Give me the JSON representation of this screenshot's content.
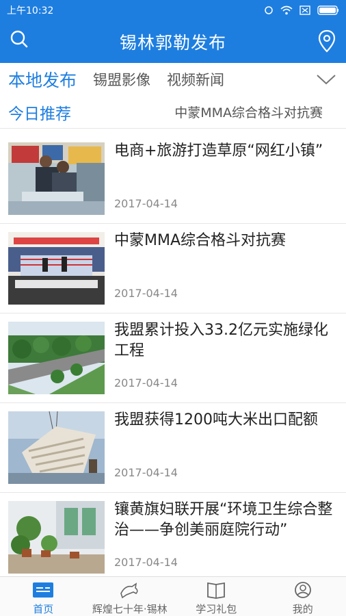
{
  "status": {
    "time": "上午10:32"
  },
  "appbar": {
    "title": "锡林郭勒发布"
  },
  "tabs": [
    {
      "label": "本地发布"
    },
    {
      "label": "锡盟影像"
    },
    {
      "label": "视频新闻"
    }
  ],
  "subtabs": {
    "active": "今日推荐",
    "other": "中蒙MMA综合格斗对抗赛"
  },
  "feed": [
    {
      "title": "电商+旅游打造草原“网红小镇”",
      "date": "2017-04-14"
    },
    {
      "title": "中蒙MMA综合格斗对抗赛",
      "date": "2017-04-14"
    },
    {
      "title": "我盟累计投入33.2亿元实施绿化工程",
      "date": "2017-04-14"
    },
    {
      "title": "我盟获得1200吨大米出口配额",
      "date": "2017-04-14"
    },
    {
      "title": "镶黄旗妇联开展“环境卫生综合整治——争创美丽庭院行动”",
      "date": "2017-04-14"
    }
  ],
  "bottom_nav": [
    {
      "label": "首页"
    },
    {
      "label": "辉煌七十年·锡林"
    },
    {
      "label": "学习礼包"
    },
    {
      "label": "我的"
    }
  ],
  "colors": {
    "brand": "#1e7ee0"
  }
}
